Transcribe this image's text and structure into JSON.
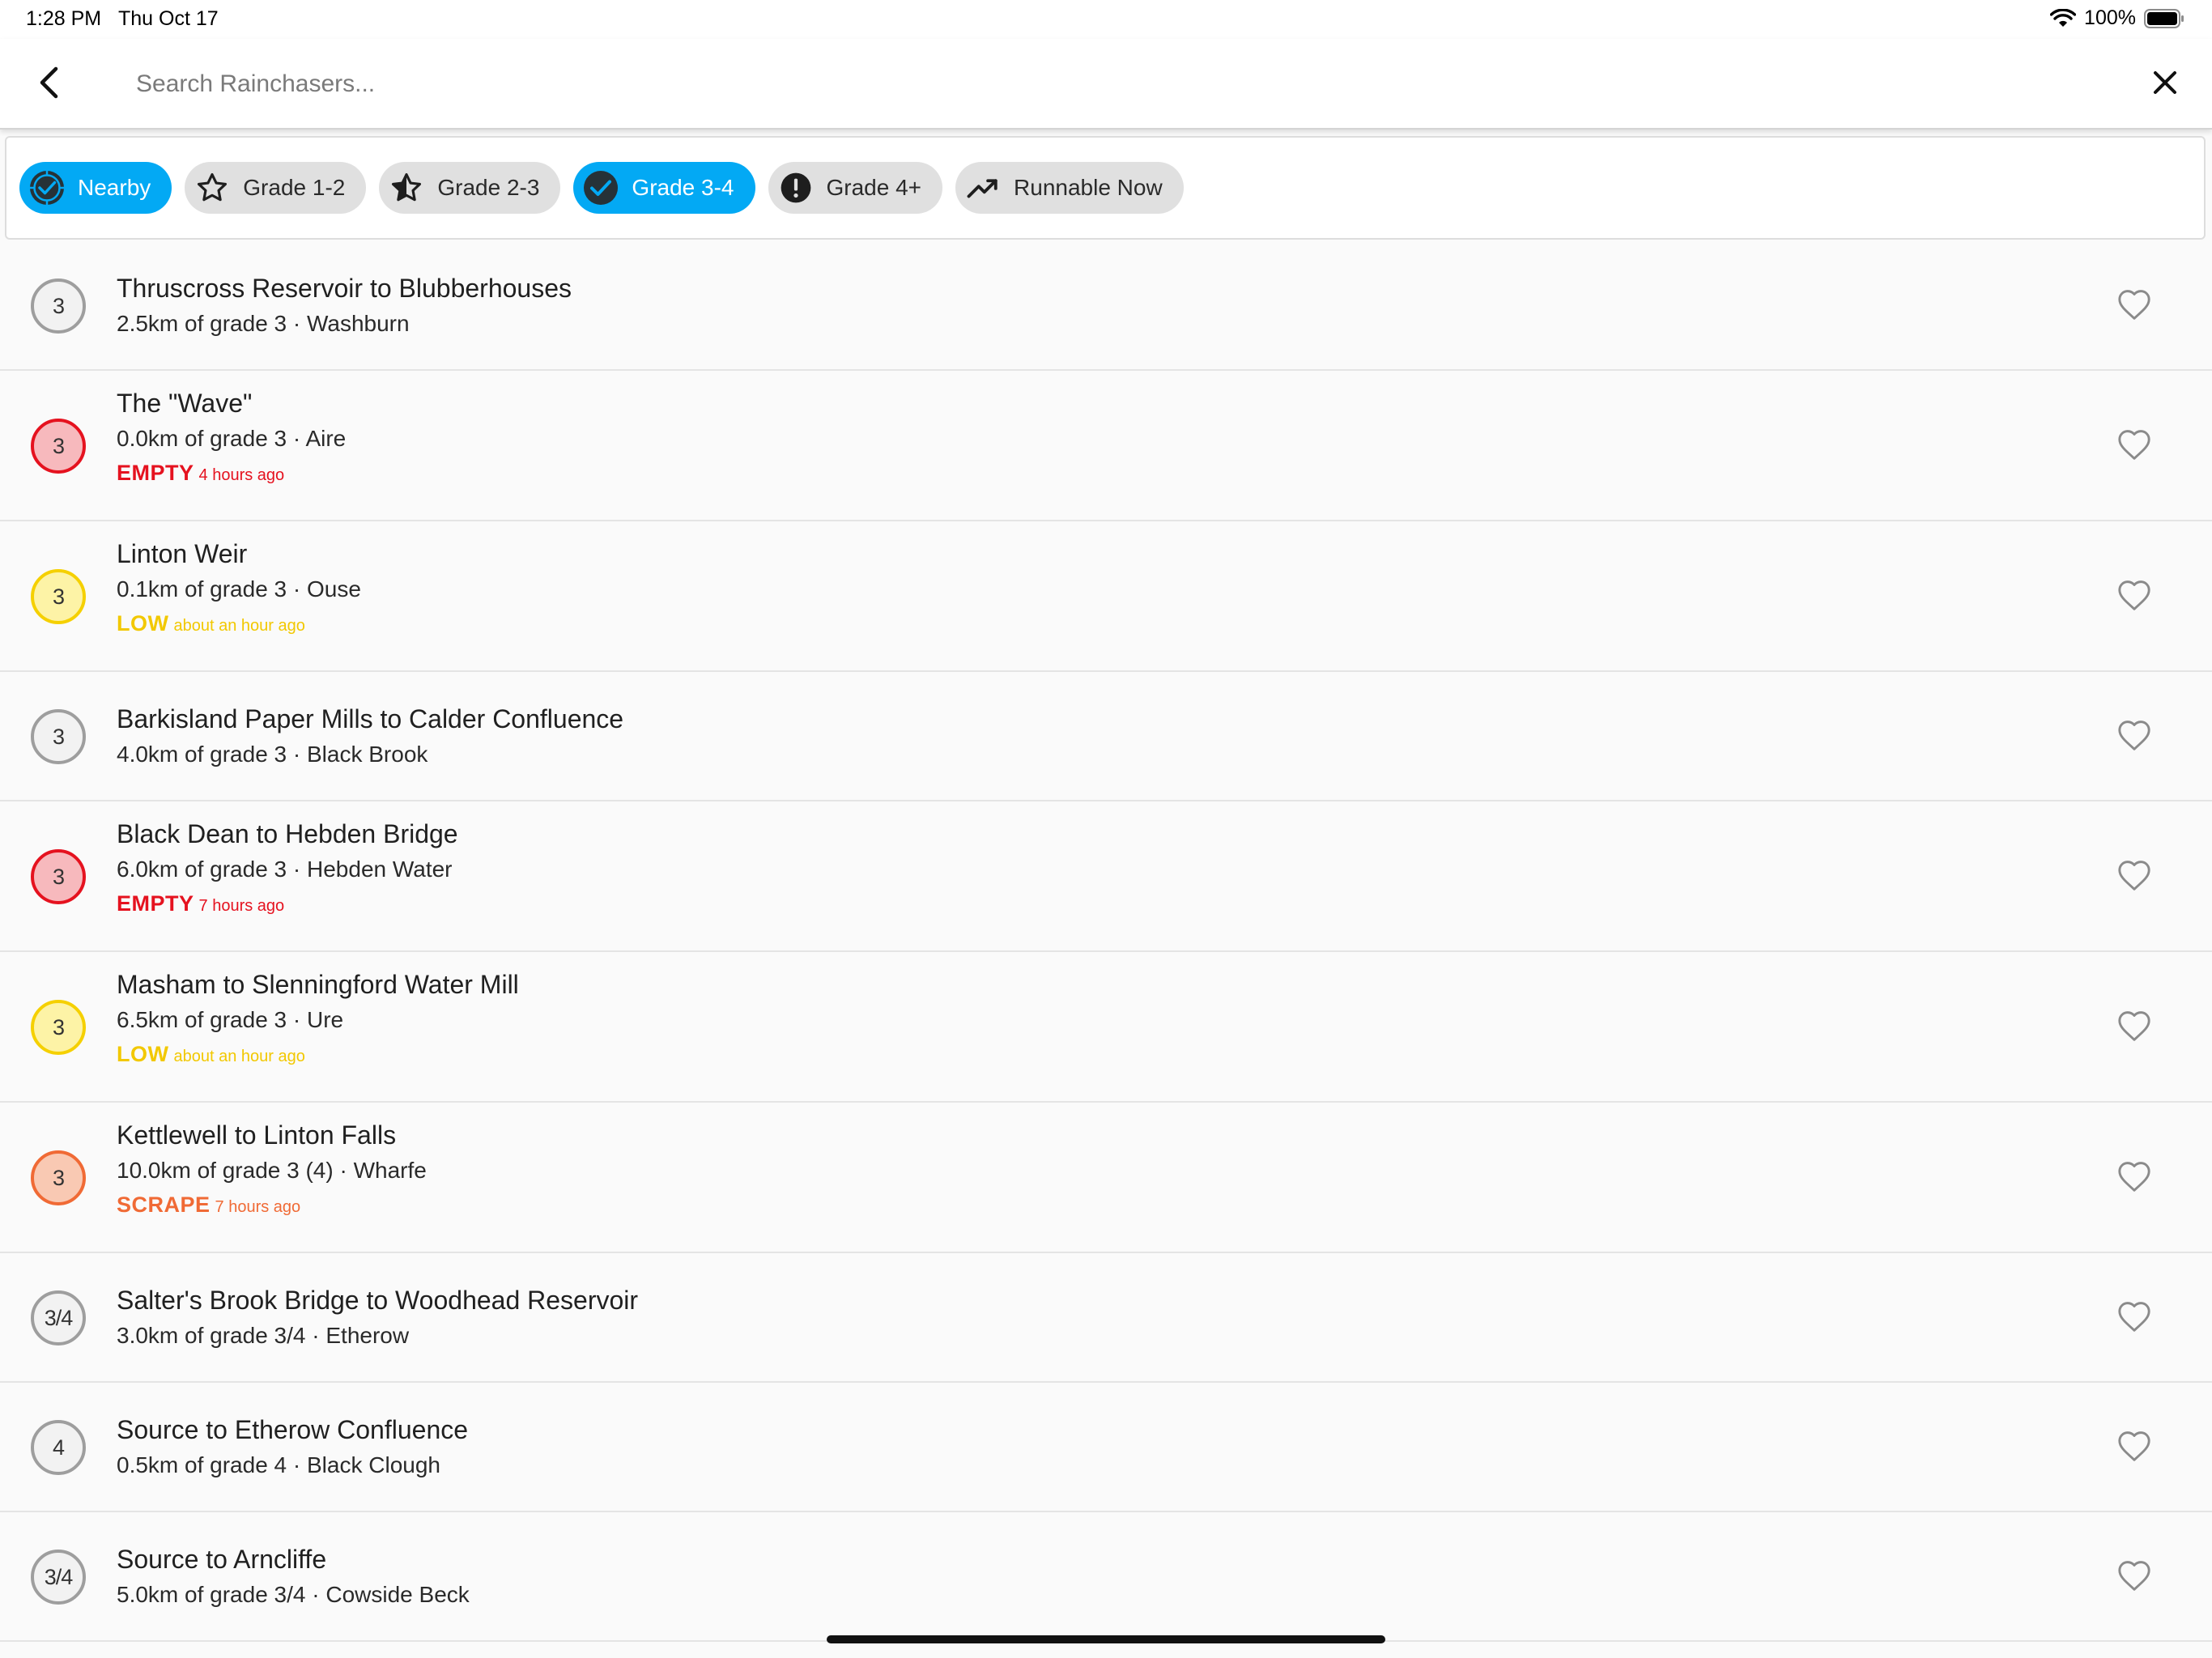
{
  "status_bar": {
    "time": "1:28 PM",
    "date": "Thu Oct 17",
    "battery": "100%"
  },
  "search": {
    "value": "",
    "placeholder": "Search Rainchasers..."
  },
  "filters": [
    {
      "label": "Nearby",
      "icon": "location-check-icon",
      "selected": true
    },
    {
      "label": "Grade 1-2",
      "icon": "star-outline-icon",
      "selected": false
    },
    {
      "label": "Grade 2-3",
      "icon": "star-half-icon",
      "selected": false
    },
    {
      "label": "Grade 3-4",
      "icon": "star-check-icon",
      "selected": true
    },
    {
      "label": "Grade 4+",
      "icon": "alert-circle-icon",
      "selected": false
    },
    {
      "label": "Runnable Now",
      "icon": "trending-up-icon",
      "selected": false
    }
  ],
  "colors": {
    "accent": "#03a9f4",
    "empty": "#e5121f",
    "low": "#f5d000",
    "scrape": "#f06a35",
    "unknown": "#9e9e9e"
  },
  "rivers": [
    {
      "grade": "3",
      "title": "Thruscross Reservoir to Blubberhouses",
      "subtitle": "2.5km of grade 3 · Washburn",
      "status": "none"
    },
    {
      "grade": "3",
      "title": "The \"Wave\"",
      "subtitle": "0.0km of grade 3 · Aire",
      "status": "empty",
      "level": "EMPTY",
      "time": "4 hours ago"
    },
    {
      "grade": "3",
      "title": "Linton Weir",
      "subtitle": "0.1km of grade 3 · Ouse",
      "status": "low",
      "level": "LOW",
      "time": "about an hour ago"
    },
    {
      "grade": "3",
      "title": "Barkisland Paper Mills to Calder Confluence",
      "subtitle": "4.0km of grade 3 · Black Brook",
      "status": "none"
    },
    {
      "grade": "3",
      "title": "Black Dean to Hebden Bridge",
      "subtitle": "6.0km of grade 3 · Hebden Water",
      "status": "empty",
      "level": "EMPTY",
      "time": "7 hours ago"
    },
    {
      "grade": "3",
      "title": "Masham to Slenningford Water Mill",
      "subtitle": "6.5km of grade 3 · Ure",
      "status": "low",
      "level": "LOW",
      "time": "about an hour ago"
    },
    {
      "grade": "3",
      "title": "Kettlewell to Linton Falls",
      "subtitle": "10.0km of grade 3 (4) · Wharfe",
      "status": "scrape",
      "level": "SCRAPE",
      "time": "7 hours ago"
    },
    {
      "grade": "3/4",
      "title": "Salter's Brook Bridge to Woodhead Reservoir",
      "subtitle": "3.0km of grade 3/4 · Etherow",
      "status": "none"
    },
    {
      "grade": "4",
      "title": "Source to Etherow Confluence",
      "subtitle": "0.5km of grade 4 · Black Clough",
      "status": "none"
    },
    {
      "grade": "3/4",
      "title": "Source to Arncliffe",
      "subtitle": "5.0km of grade 3/4 · Cowside Beck",
      "status": "none"
    }
  ]
}
